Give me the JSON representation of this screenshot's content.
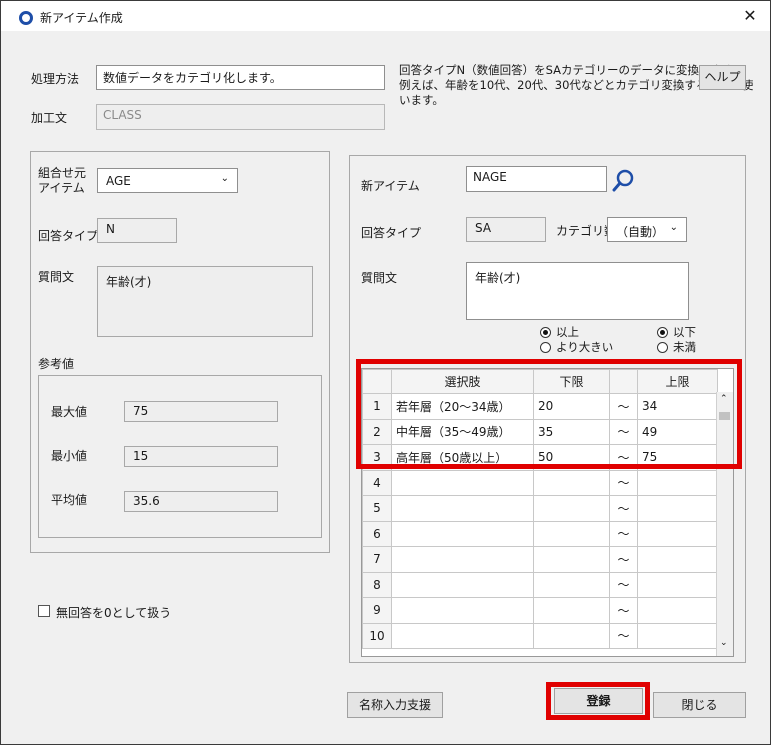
{
  "window": {
    "title": "新アイテム作成",
    "close_glyph": "✕"
  },
  "top": {
    "method_label": "処理方法",
    "method_value": "数値データをカテゴリ化します。",
    "processed_label": "加工文",
    "processed_value": "CLASS",
    "description": [
      "回答タイプN（数値回答）をSAカテゴリーのデータに変換します。",
      "例えば、年齢を10代、20代、30代などとカテゴリ変換するときに使",
      "います。"
    ],
    "help_label": "ヘルプ"
  },
  "left": {
    "source_label": [
      "組合せ元",
      "アイテム"
    ],
    "source_value": "AGE",
    "answer_type_label": "回答タイプ",
    "answer_type_value": "N",
    "question_label": "質問文",
    "question_value": "年齢(才)",
    "reference_label": "参考値",
    "max_label": "最大値",
    "max_value": "75",
    "min_label": "最小値",
    "min_value": "15",
    "avg_label": "平均値",
    "avg_value": "35.6",
    "no_answer_label": "無回答を0として扱う"
  },
  "right": {
    "new_item_label": "新アイテム",
    "new_item_value": "NAGE",
    "answer_type_label": "回答タイプ",
    "answer_type_value": "SA",
    "category_count_label": "カテゴリ数",
    "category_count_value": "（自動）",
    "question_label": "質問文",
    "question_value": "年齢(才)",
    "lower_opts": [
      "以上",
      "より大きい"
    ],
    "upper_opts": [
      "以下",
      "未満"
    ]
  },
  "grid": {
    "headers": [
      "",
      "選択肢",
      "下限",
      "",
      "上限"
    ],
    "rows": [
      {
        "n": "1",
        "label": "若年層（20～34歳）",
        "low": "20",
        "tilde": "～",
        "high": "34"
      },
      {
        "n": "2",
        "label": "中年層（35～49歳）",
        "low": "35",
        "tilde": "～",
        "high": "49"
      },
      {
        "n": "3",
        "label": "高年層（50歳以上）",
        "low": "50",
        "tilde": "～",
        "high": "75"
      },
      {
        "n": "4",
        "label": "",
        "low": "",
        "tilde": "～",
        "high": ""
      },
      {
        "n": "5",
        "label": "",
        "low": "",
        "tilde": "～",
        "high": ""
      },
      {
        "n": "6",
        "label": "",
        "low": "",
        "tilde": "～",
        "high": ""
      },
      {
        "n": "7",
        "label": "",
        "low": "",
        "tilde": "～",
        "high": ""
      },
      {
        "n": "8",
        "label": "",
        "low": "",
        "tilde": "～",
        "high": ""
      },
      {
        "n": "9",
        "label": "",
        "low": "",
        "tilde": "～",
        "high": ""
      },
      {
        "n": "10",
        "label": "",
        "low": "",
        "tilde": "～",
        "high": ""
      }
    ]
  },
  "footer": {
    "name_assist_label": "名称入力支援",
    "register_label": "登録",
    "close_label": "閉じる"
  },
  "colors": {
    "highlight": "#e00000",
    "accent": "#1e4ea8"
  }
}
